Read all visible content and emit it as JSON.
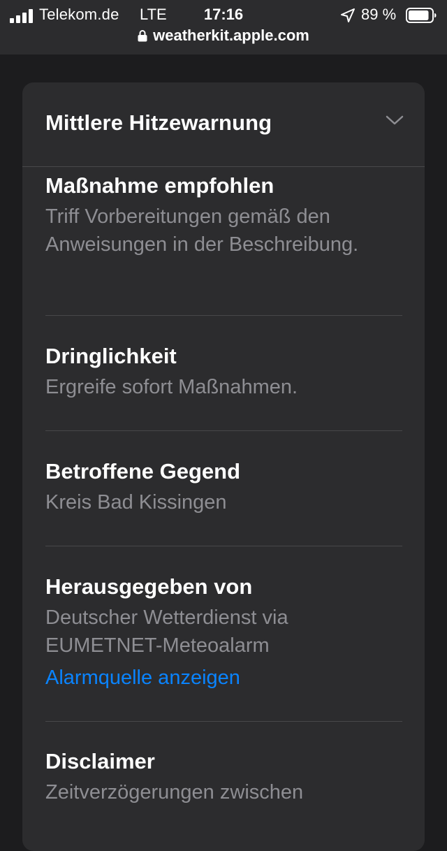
{
  "status_bar": {
    "carrier": "Telekom.de",
    "network": "LTE",
    "time": "17:16",
    "battery_percent": "89 %",
    "battery_level": 0.89,
    "signal_bars": 4
  },
  "url_bar": {
    "domain": "weatherkit.apple.com"
  },
  "alert_card": {
    "title": "Mittlere Hitzewarnung",
    "sections": [
      {
        "title": "Maßnahme empfohlen",
        "text": "Triff Vorbereitungen gemäß den Anweisungen in der Beschreibung."
      },
      {
        "title": "Dringlichkeit",
        "text": "Ergreife sofort Maßnahmen."
      },
      {
        "title": "Betroffene Gegend",
        "text": "Kreis Bad Kissingen"
      },
      {
        "title": "Herausgegeben von",
        "text": "Deutscher Wetterdienst via EUMETNET-Meteoalarm",
        "link": "Alarmquelle anzeigen"
      },
      {
        "title": "Disclaimer",
        "text": "Zeitverzögerungen zwischen"
      }
    ]
  },
  "colors": {
    "background": "#1c1c1e",
    "card": "#2c2c2e",
    "secondary_text": "#8e8e93",
    "link": "#0a84ff"
  }
}
